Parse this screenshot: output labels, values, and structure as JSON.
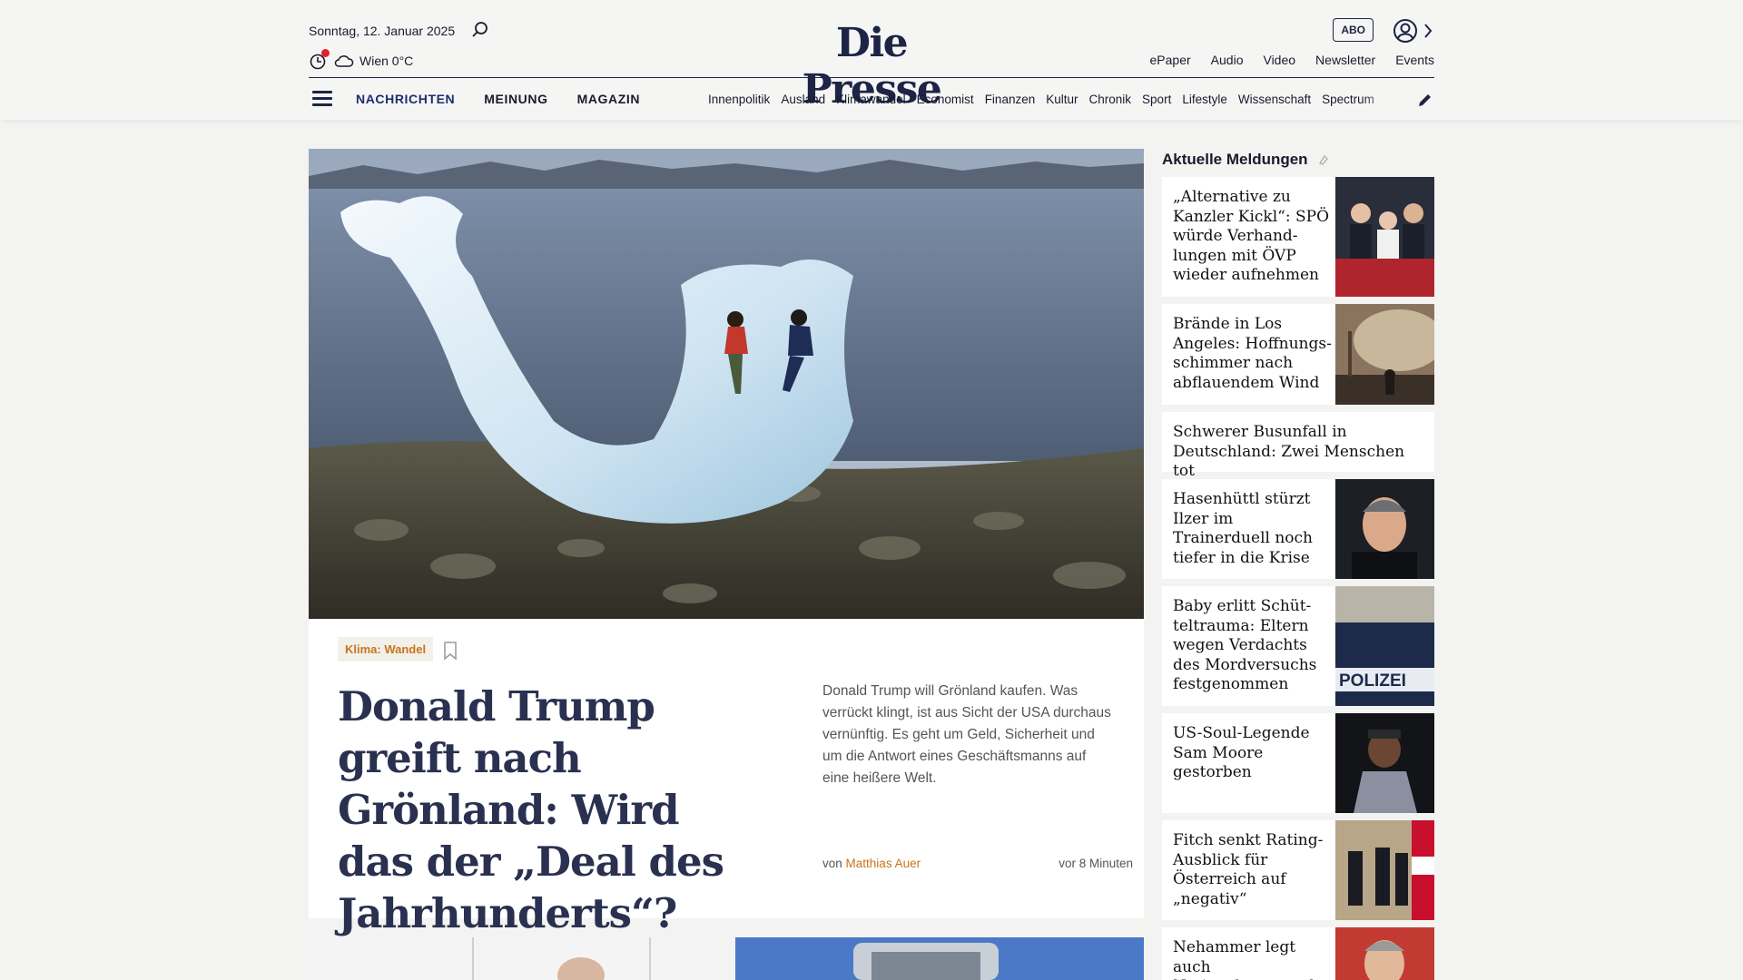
{
  "header": {
    "date": "Sonntag, 12. Januar 2025",
    "weather": "Wien 0°C",
    "logo": "Die Presse",
    "abo_label": "ABO",
    "top_links": [
      "ePaper",
      "Audio",
      "Video",
      "Newsletter",
      "Events"
    ],
    "main_nav": [
      "NACHRICHTEN",
      "MEINUNG",
      "MAGAZIN"
    ],
    "sub_nav": [
      "Innenpolitik",
      "Ausland",
      "Klimawandel",
      "Economist",
      "Finanzen",
      "Kultur",
      "Chronik",
      "Sport",
      "Lifestyle",
      "Wissenschaft",
      "Spectrum"
    ]
  },
  "hero": {
    "tag": "Klima: Wandel",
    "headline": "Donald Trump greift nach Grönland: Wird das der „Deal des Jahrhunderts“?",
    "teaser": "Donald Trump will Grönland kaufen. Was verrückt klingt, ist aus Sicht der USA durchaus vernünftig. Es geht um Geld, Sicherheit und um die Antwort eines Geschäftsmanns auf eine heißere Welt.",
    "byline_prefix": "von",
    "author": "Matthias Auer",
    "time_ago": "vor 8 Minuten"
  },
  "sidebar": {
    "title": "Aktuelle Meldungen",
    "items": [
      {
        "text": "„Alternative zu Kanzler Kickl“: SPÖ würde Verhand­lungen mit ÖVP wieder aufnehmen"
      },
      {
        "text": "Brände in Los Angeles: Hoffnungs­schimmer nach abflauendem Wind"
      },
      {
        "text": "Schwerer Busunfall in Deutschland: Zwei Menschen tot"
      },
      {
        "text": "Hasenhüttl stürzt Ilzer im Trainerduell noch tiefer in die Krise"
      },
      {
        "text": "Baby erlitt Schüt­teltrauma: Eltern wegen Verdachts des Mordversuchs festgenommen"
      },
      {
        "text": "US-Soul-Legende Sam Moore gestorben"
      },
      {
        "text": "Fitch senkt Rating-Ausblick für Österreich auf „negativ“"
      },
      {
        "text": "Nehammer legt auch Nationalratsmandat"
      }
    ]
  },
  "colors": {
    "brand_navy": "#1d2446",
    "accent_orange": "#c8751b",
    "alert_red": "#e0202a"
  }
}
